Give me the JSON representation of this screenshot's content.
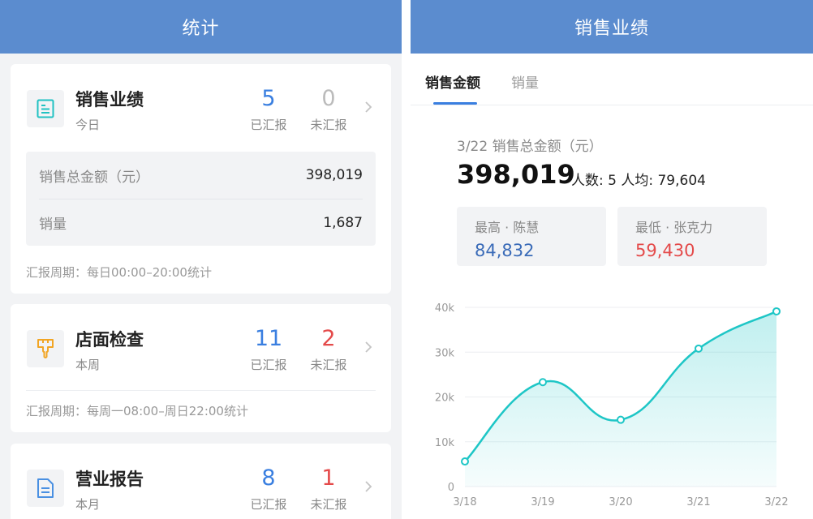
{
  "left": {
    "header_title": "统计",
    "cards": [
      {
        "title": "销售业绩",
        "period": "今日",
        "icon": "document-icon",
        "reported_count": "5",
        "reported_label": "已汇报",
        "unreported_count": "0",
        "unreported_label": "未汇报",
        "metrics": [
          {
            "label": "销售总金额（元）",
            "value": "398,019"
          },
          {
            "label": "销量",
            "value": "1,687"
          }
        ],
        "footer": "汇报周期：每日00:00–20:00统计"
      },
      {
        "title": "店面检查",
        "period": "本周",
        "icon": "brush-icon",
        "reported_count": "11",
        "reported_label": "已汇报",
        "unreported_count": "2",
        "unreported_label": "未汇报",
        "footer": "汇报周期：每周一08:00–周日22:00统计"
      },
      {
        "title": "营业报告",
        "period": "本月",
        "icon": "file-icon",
        "reported_count": "8",
        "reported_label": "已汇报",
        "unreported_count": "1",
        "unreported_label": "未汇报"
      }
    ],
    "colors": {
      "header": "#5b8ccf",
      "reported": "#3a7fe0",
      "unreported_zero": "#bbbbbb",
      "unreported_nonzero": "#e44a4a"
    }
  },
  "right": {
    "header_title": "销售业绩",
    "tabs": [
      {
        "label": "销售金额",
        "active": true
      },
      {
        "label": "销量",
        "active": false
      }
    ],
    "summary": {
      "title": "3/22 销售总金额（元）",
      "total": "398,019",
      "headcount": "人数: 5  人均: 79,604"
    },
    "highest": {
      "label": "最高 · 陈慧",
      "value": "84,832"
    },
    "lowest": {
      "label": "最低 · 张克力",
      "value": "59,430"
    }
  },
  "chart_data": {
    "type": "area",
    "x": [
      "3/18",
      "3/19",
      "3/20",
      "3/21",
      "3/22"
    ],
    "values": [
      5600,
      23300,
      14900,
      30800,
      39100
    ],
    "yticks": [
      "0",
      "10k",
      "20k",
      "30k",
      "40k"
    ],
    "ylim": [
      0,
      40000
    ],
    "grid": true,
    "color": "#1ec6c6"
  }
}
